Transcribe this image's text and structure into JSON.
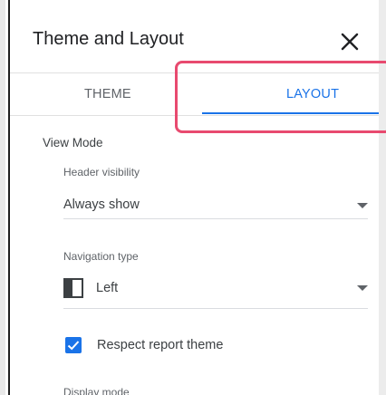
{
  "panel": {
    "title": "Theme and Layout"
  },
  "tabs": [
    {
      "label": "THEME",
      "active": false
    },
    {
      "label": "LAYOUT",
      "active": true
    }
  ],
  "view_mode": {
    "section_title": "View Mode",
    "header_visibility": {
      "label": "Header visibility",
      "value": "Always show"
    },
    "navigation_type": {
      "label": "Navigation type",
      "value": "Left",
      "icon": "left-navigation-icon"
    },
    "respect_report_theme": {
      "label": "Respect report theme",
      "checked": true
    },
    "display_mode": {
      "label": "Display mode"
    }
  },
  "colors": {
    "accent": "#1a73e8",
    "highlight": "#e84a6f"
  }
}
